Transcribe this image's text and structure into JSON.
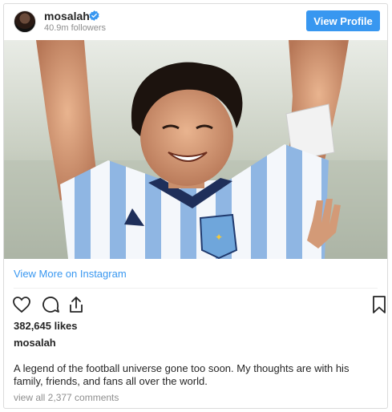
{
  "header": {
    "username": "mosalah",
    "verified": true,
    "followers": "40.9m followers",
    "view_profile_label": "View Profile"
  },
  "post": {
    "view_more_label": "View More on Instagram",
    "likes": "382,645 likes",
    "caption_username": "mosalah",
    "caption": "A legend of the football universe gone too soon. My thoughts are with his family, friends, and fans all over the world.",
    "view_comments": "view all 2,377 comments"
  },
  "icons": {
    "like": "heart-icon",
    "comment": "comment-icon",
    "share": "share-icon",
    "save": "bookmark-icon",
    "verified": "verified-badge-icon"
  },
  "colors": {
    "accent": "#3897f0",
    "text": "#262626",
    "muted": "#8e8e8e"
  }
}
